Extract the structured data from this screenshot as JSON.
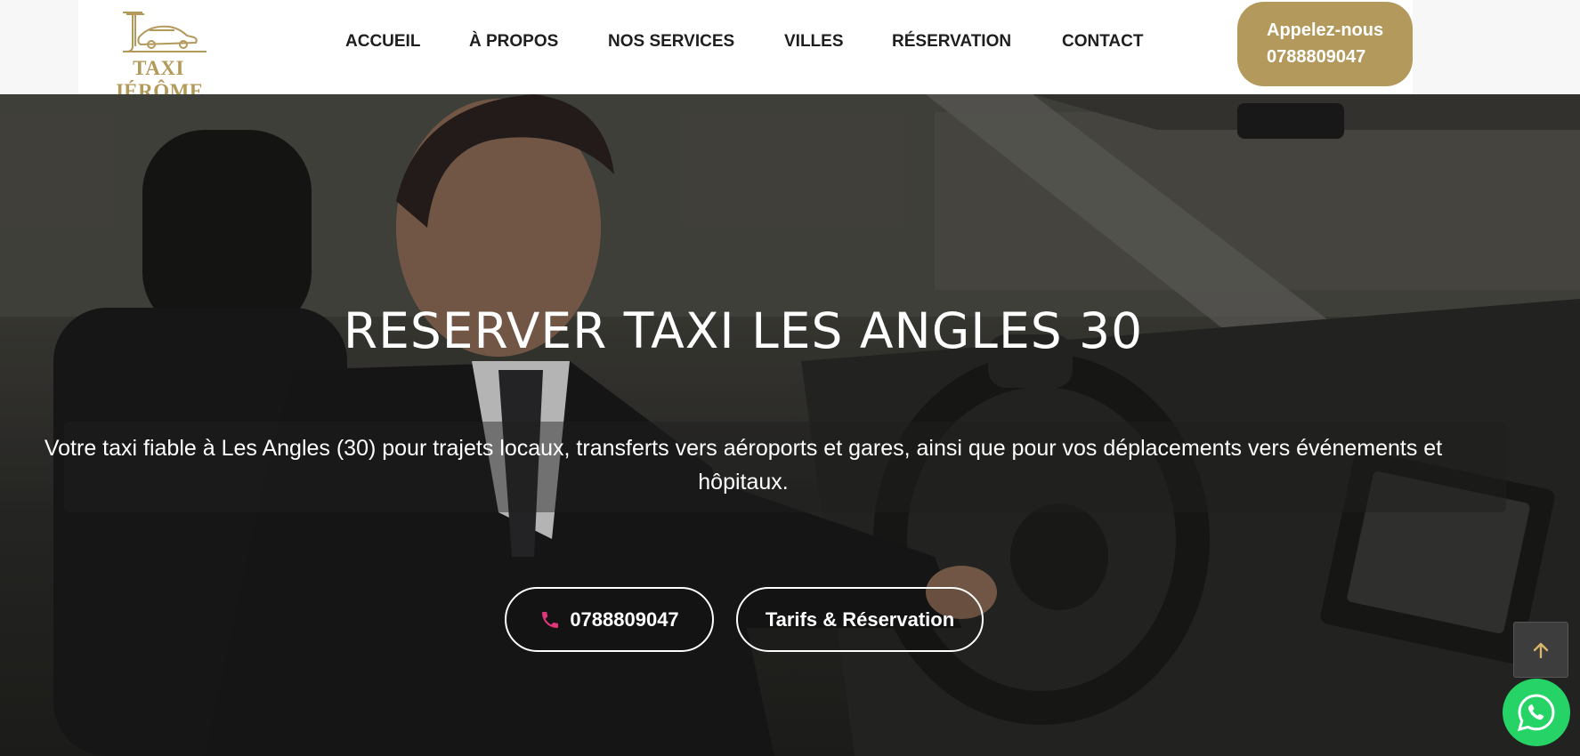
{
  "brand": {
    "name": "TAXI JÉRÔME",
    "accent_color": "#b39a5c",
    "logo_icon": "taxi-car-monogram-icon"
  },
  "nav": {
    "items": [
      {
        "label": "ACCUEIL"
      },
      {
        "label": "À PROPOS"
      },
      {
        "label": "NOS SERVICES"
      },
      {
        "label": "VILLES"
      },
      {
        "label": "RÉSERVATION"
      },
      {
        "label": "CONTACT"
      }
    ]
  },
  "call_cta": {
    "line1": "Appelez-nous",
    "line2": "0788809047"
  },
  "hero": {
    "title": "RESERVER TAXI LES ANGLES 30",
    "subtitle": "Votre taxi fiable à Les Angles (30) pour trajets locaux, transferts vers aéroports et gares, ainsi que pour vos déplacements vers événements et hôpitaux.",
    "phone_button": {
      "label": "0788809047",
      "icon": "phone-icon",
      "icon_color": "#e0357a"
    },
    "tarifs_button": {
      "label": "Tarifs & Réservation"
    }
  },
  "floating": {
    "scroll_top_icon": "arrow-up-icon",
    "whatsapp_icon": "whatsapp-icon",
    "whatsapp_color": "#25d366"
  }
}
